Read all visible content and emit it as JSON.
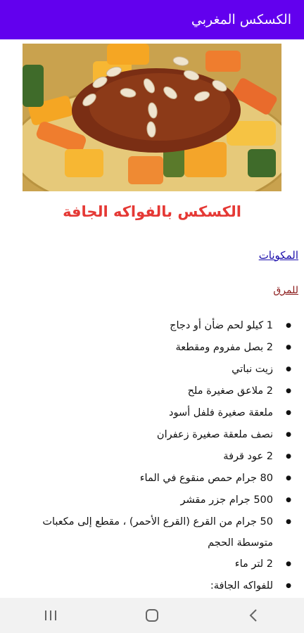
{
  "appbar": {
    "title": "الكسكس المغربي"
  },
  "recipe": {
    "title": "الكسكس بالفواكه الجافة",
    "section_label": "المكونات",
    "subsection_label": "للمرق",
    "ingredients": [
      "1 كيلو لحم ضأن أو دجاج",
      "2 بصل مفروم ومقطعة",
      "زيت نباتي",
      "2 ملاعق صغيرة ملح",
      "ملعقة صغيرة فلفل أسود",
      "نصف ملعقة صغيرة زعفران",
      "2 عود قرفة",
      "80 جرام حمص منقوع في الماء",
      "500 جرام جزر مقشر",
      "50 جرام من القرع (القرع الأحمر) ، مقطع إلى مكعبات متوسطة الحجم",
      "2 لتر ماء",
      "للفواكه الجافة:"
    ]
  },
  "colors": {
    "appbar": "#6200ee",
    "title": "#e53935",
    "link": "#1a0dab",
    "sublink": "#8b1a1a"
  },
  "navbar": {
    "icons": [
      "recent-apps-icon",
      "home-icon",
      "back-icon"
    ]
  }
}
